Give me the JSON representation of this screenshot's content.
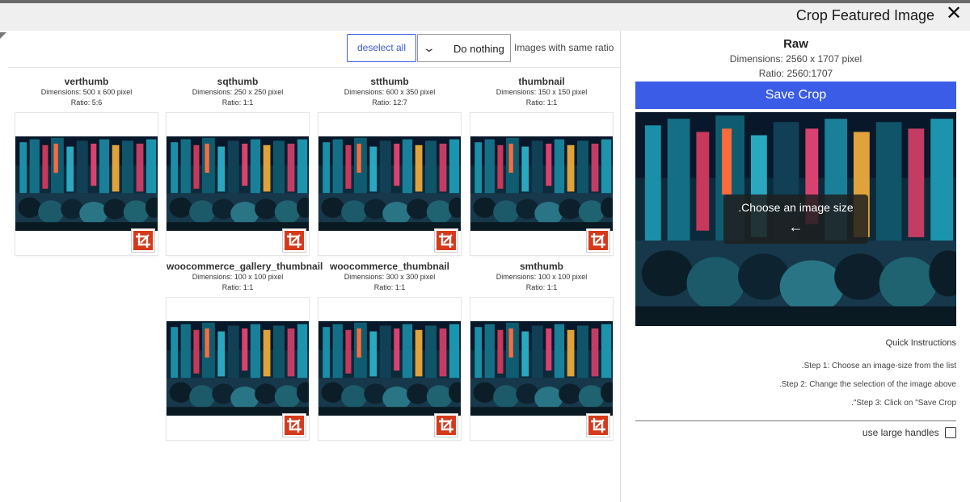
{
  "header": {
    "title": "Crop Featured Image",
    "close_icon": "close-icon"
  },
  "toolbar": {
    "deselect_label": "deselect all",
    "action_select_value": "Do nothing",
    "ratio_label": "Images with same ratio"
  },
  "thumbnails": [
    {
      "name": "verthumb",
      "dimensions": "Dimensions: 500 x 600 pixel",
      "ratio": "Ratio: 5:6",
      "icon": "crop-icon"
    },
    {
      "name": "sqthumb",
      "dimensions": "Dimensions: 250 x 250 pixel",
      "ratio": "Ratio: 1:1",
      "icon": "crop-icon"
    },
    {
      "name": "stthumb",
      "dimensions": "Dimensions: 600 x 350 pixel",
      "ratio": "Ratio: 12:7",
      "icon": "crop-icon"
    },
    {
      "name": "thumbnail",
      "dimensions": "Dimensions: 150 x 150 pixel",
      "ratio": "Ratio: 1:1",
      "icon": "crop-icon"
    },
    {
      "name": "woocommerce_gallery_thumbnail",
      "dimensions": "Dimensions: 100 x 100 pixel",
      "ratio": "Ratio: 1:1",
      "icon": "crop-icon"
    },
    {
      "name": "woocommerce_thumbnail",
      "dimensions": "Dimensions: 300 x 300 pixel",
      "ratio": "Ratio: 1:1",
      "icon": "crop-icon"
    },
    {
      "name": "smthumb",
      "dimensions": "Dimensions: 100 x 100 pixel",
      "ratio": "Ratio: 1:1",
      "icon": "crop-icon"
    }
  ],
  "raw": {
    "title": "Raw",
    "dimensions": "Dimensions: 2560 x 1707 pixel",
    "ratio": "Ratio: 2560:1707"
  },
  "save_button": "Save Crop",
  "preview_hint": ".Choose an image size",
  "preview_hint_arrow": "←",
  "quick_instructions": {
    "title": "Quick Instructions",
    "steps": [
      ".Step 1: Choose an image-size from the list",
      ".Step 2: Change the selection of the image above",
      ".\"Step 3: Click on \"Save Crop"
    ]
  },
  "large_handles_label": "use large handles",
  "colors": {
    "accent": "#3a5ce6",
    "crop_badge": "#d63a1b"
  }
}
